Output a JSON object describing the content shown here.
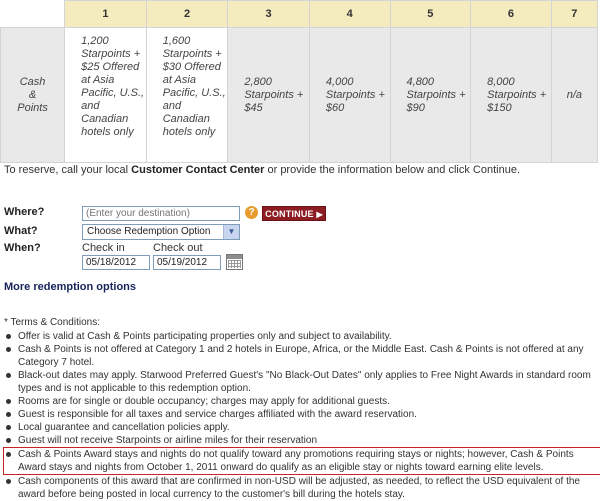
{
  "table": {
    "categories": [
      "1",
      "2",
      "3",
      "4",
      "5",
      "6",
      "7"
    ],
    "row_label": [
      "Cash",
      "&",
      "Points"
    ],
    "cells": [
      "1,200 Starpoints + $25 Offered at Asia Pacific, U.S., and Canadian hotels only",
      "1,600 Starpoints + $30 Offered at Asia Pacific, U.S., and Canadian hotels only",
      "2,800 Starpoints + $45",
      "4,000 Starpoints + $60",
      "4,800 Starpoints + $90",
      "8,000 Starpoints + $150",
      "n/a"
    ]
  },
  "reserve": {
    "before": "To reserve, call your local ",
    "link": "Customer Contact Center",
    "after": " or provide the information below and click Continue."
  },
  "form": {
    "where_label": "Where?",
    "destination_placeholder": "(Enter your destination)",
    "continue_label": "CONTINUE",
    "what_label": "What?",
    "what_selected": "Choose Redemption Option",
    "when_label": "When?",
    "checkin_label": "Check in",
    "checkout_label": "Check out",
    "checkin_value": "05/18/2012",
    "checkout_value": "05/19/2012"
  },
  "more_link": "More redemption options",
  "terms": {
    "heading": "* Terms & Conditions:",
    "items": [
      "Offer is valid at Cash & Points participating properties only and subject to availability.",
      "Cash & Points is not offered at Category 1 and 2 hotels in Europe, Africa, or the Middle East. Cash & Points is not offered at any Category 7 hotel.",
      "Black-out dates may apply. Starwood Preferred Guest's \"No Black-Out Dates\" only applies to Free Night Awards in standard room types and is not applicable to this redemption option.",
      "Rooms are for single or double occupancy; charges may apply for additional guests.",
      "Guest is responsible for all taxes and service charges affiliated with the award reservation.",
      "Local guarantee and cancellation policies apply.",
      "Guest will not receive Starpoints or airline miles for their reservation",
      "Cash & Points Award stays and nights do not qualify toward any promotions requiring stays or nights; however, Cash & Points Award stays and nights from October 1, 2011 onward do qualify as an eligible stay or nights toward earning elite levels.",
      "Cash components of this award that are confirmed in non-USD will be adjusted, as needed, to reflect the USD equivalent of the award before being posted in local currency to the customer's bill during the hotels stay."
    ],
    "highlighted_index": 7
  }
}
